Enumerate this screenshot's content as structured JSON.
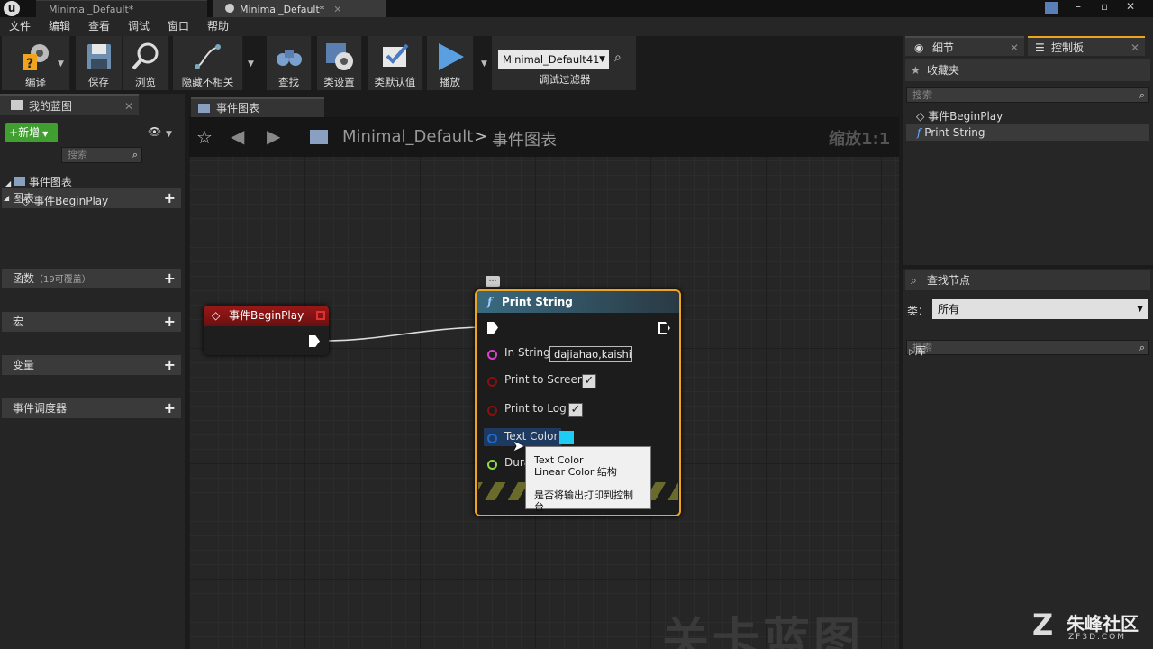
{
  "window": {
    "tabs": [
      {
        "label": "Minimal_Default*",
        "active": false
      },
      {
        "label": "Minimal_Default*",
        "active": true
      }
    ]
  },
  "menu": [
    "文件",
    "编辑",
    "查看",
    "调试",
    "窗口",
    "帮助"
  ],
  "toolbar": {
    "compile": "编译",
    "save": "保存",
    "browse": "浏览",
    "hide_unrelated": "隐藏不相关",
    "find": "查找",
    "class_settings": "类设置",
    "class_defaults": "类默认值",
    "play": "播放",
    "debug_filter_value": "Minimal_Default41",
    "debug_filter_label": "调试过滤器"
  },
  "left_panel": {
    "tab": "我的蓝图",
    "new_button": "新增",
    "search_placeholder": "搜索",
    "sections": {
      "graphs": "图表",
      "event_graph": "事件图表",
      "event_beginplay": "事件BeginPlay",
      "functions": "函数",
      "functions_note": "（19可覆盖）",
      "macros": "宏",
      "variables": "变量",
      "event_dispatchers": "事件调度器"
    }
  },
  "graph": {
    "tab": "事件图表",
    "breadcrumb_root": "Minimal_Default",
    "breadcrumb_sep": ">",
    "breadcrumb_leaf": "事件图表",
    "zoom": "缩放1:1",
    "watermark": "关卡蓝图",
    "begin_node_title": "事件BeginPlay",
    "print_node": {
      "title": "Print String",
      "in_string_label": "In String",
      "in_string_value": "dajiahao,kaishi",
      "print_to_screen": "Print to Screen",
      "print_to_log": "Print to Log",
      "text_color": "Text Color",
      "duration": "Duration"
    },
    "tooltip": {
      "line1": "Text Color",
      "line2": "Linear Color 结构",
      "line3": "是否将输出打印到控制台"
    }
  },
  "right_panel": {
    "tab_details": "细节",
    "tab_palette": "控制板",
    "favorites": "收藏夹",
    "search_placeholder": "搜索",
    "fav_items": [
      "事件BeginPlay",
      "Print String"
    ],
    "find_node": "查找节点",
    "category_label": "类：",
    "category_value": "所有",
    "library": "库"
  },
  "logo": {
    "text": "朱峰社区",
    "sub": "ZF3D.COM"
  },
  "colors": {
    "node_border": "#f0a41e",
    "event_header": "#8c1414",
    "function_header": "#3c6478",
    "new_button": "#3f9f2f",
    "text_color_swatch": "#1ecbf2"
  }
}
